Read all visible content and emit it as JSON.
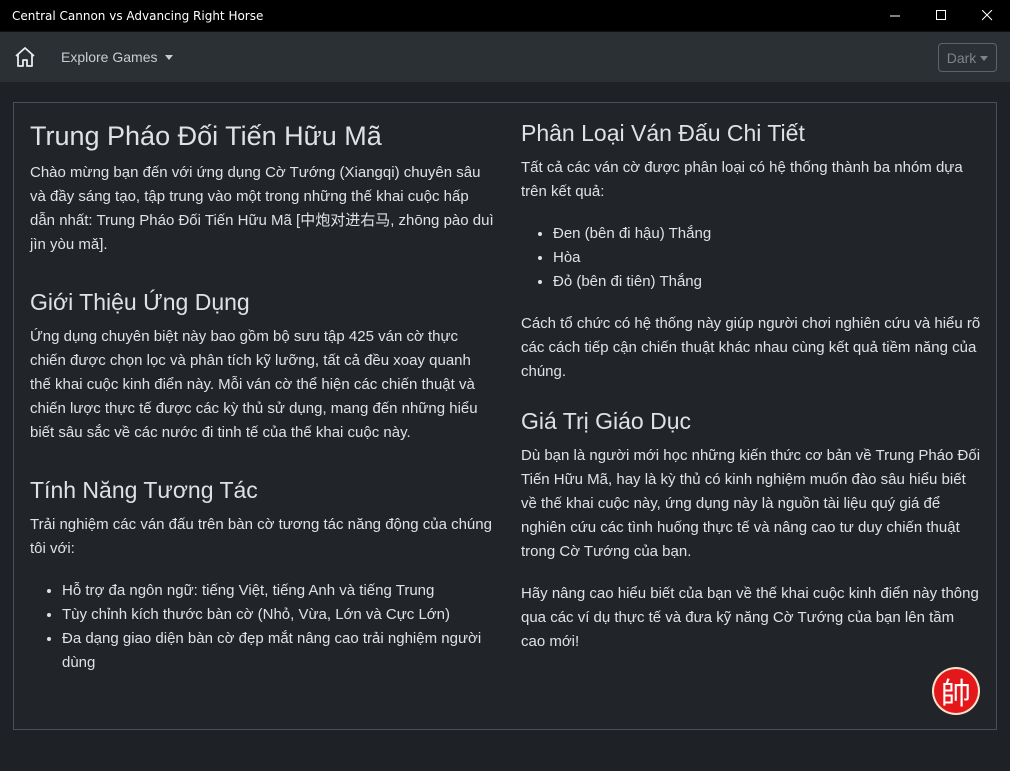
{
  "window": {
    "title": "Central Cannon vs Advancing Right Horse"
  },
  "navbar": {
    "home_icon": "home-icon",
    "explore_label": "Explore Games",
    "theme_label": "Dark"
  },
  "left": {
    "title": "Trung Pháo Đối Tiến Hữu Mã",
    "intro": "Chào mừng bạn đến với ứng dụng Cờ Tướng (Xiangqi) chuyên sâu và đầy sáng tạo, tập trung vào một trong những thế khai cuộc hấp dẫn nhất: Trung Pháo Đối Tiến Hữu Mã [中炮对进右马, zhōng pào duì jìn yòu mǎ].",
    "about_heading": "Giới Thiệu Ứng Dụng",
    "about_text": "Ứng dụng chuyên biệt này bao gồm bộ sưu tập 425 ván cờ thực chiến được chọn lọc và phân tích kỹ lưỡng, tất cả đều xoay quanh thế khai cuộc kinh điển này. Mỗi ván cờ thể hiện các chiến thuật và chiến lược thực tế được các kỳ thủ sử dụng, mang đến những hiểu biết sâu sắc về các nước đi tinh tế của thế khai cuộc này.",
    "features_heading": "Tính Năng Tương Tác",
    "features_text": "Trải nghiệm các ván đấu trên bàn cờ tương tác năng động của chúng tôi với:",
    "features": [
      "Hỗ trợ đa ngôn ngữ: tiếng Việt, tiếng Anh và tiếng Trung",
      "Tùy chỉnh kích thước bàn cờ (Nhỏ, Vừa, Lớn và Cực Lớn)",
      "Đa dạng giao diện bàn cờ đẹp mắt nâng cao trải nghiệm người dùng"
    ]
  },
  "right": {
    "classify_heading": "Phân Loại Ván Đấu Chi Tiết",
    "classify_text": "Tất cả các ván cờ được phân loại có hệ thống thành ba nhóm dựa trên kết quả:",
    "results": [
      "Đen (bên đi hậu) Thắng",
      "Hòa",
      "Đỏ (bên đi tiên) Thắng"
    ],
    "classify_note": "Cách tổ chức có hệ thống này giúp người chơi nghiên cứu và hiểu rõ các cách tiếp cận chiến thuật khác nhau cùng kết quả tiềm năng của chúng.",
    "edu_heading": "Giá Trị Giáo Dục",
    "edu_text": "Dù bạn là người mới học những kiến thức cơ bản về Trung Pháo Đối Tiến Hữu Mã, hay là kỳ thủ có kinh nghiệm muốn đào sâu hiểu biết về thế khai cuộc này, ứng dụng này là nguồn tài liệu quý giá để nghiên cứu các tình huống thực tế và nâng cao tư duy chiến thuật trong Cờ Tướng của bạn.",
    "closing_text": "Hãy nâng cao hiểu biết của bạn về thế khai cuộc kinh điển này thông qua các ví dụ thực tế và đưa kỹ năng Cờ Tướng của bạn lên tầm cao mới!"
  },
  "logo": {
    "glyph": "帥",
    "color": "#e4181b"
  }
}
